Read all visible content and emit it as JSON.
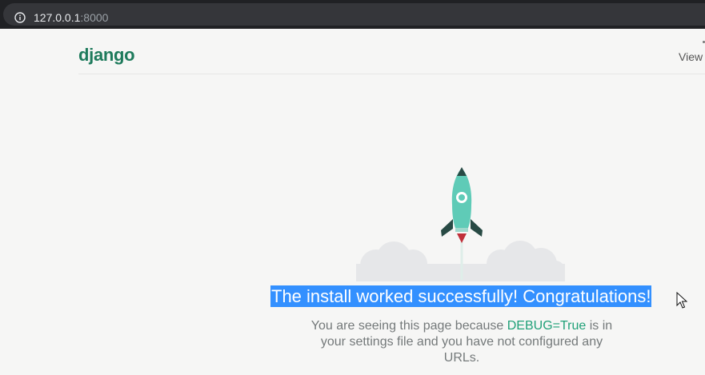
{
  "browser": {
    "url_host": "127.0.0.1",
    "url_port": ":8000"
  },
  "header": {
    "logo": "django",
    "view_link": "View"
  },
  "main": {
    "title": "The install worked successfully! Congratulations!",
    "desc_before": "You are seeing this page because ",
    "desc_code": "DEBUG=True",
    "desc_after": " is in your settings file and you have not configured any URLs."
  },
  "icons": [
    "info-icon",
    "rocket-icon",
    "cloud-icon",
    "mouse-cursor-icon"
  ],
  "colors": {
    "brand": "#1d7a5b",
    "rocket": "#5fcbb7",
    "selection": "#3390ff",
    "code": "#20a078"
  }
}
